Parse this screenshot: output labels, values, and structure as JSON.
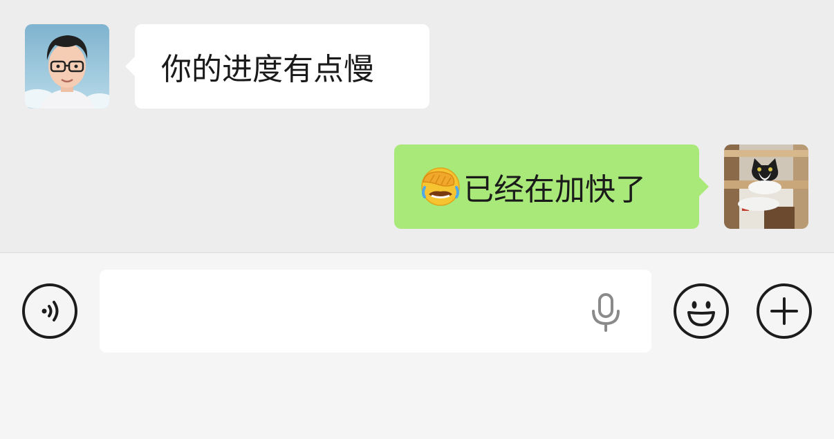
{
  "messages": [
    {
      "side": "left",
      "text": "你的进度有点慢",
      "avatar": "man-with-glasses-avatar"
    },
    {
      "side": "right",
      "emoji": "face-with-hand-over-eyes-laughing-emoji",
      "text": "已经在加快了",
      "avatar": "black-white-cat-avatar"
    }
  ],
  "input_bar": {
    "input_value": "",
    "placeholder": "",
    "icons": [
      "voice-icon",
      "microphone-icon",
      "emoji-icon",
      "plus-icon"
    ]
  },
  "colors": {
    "chat_background": "#ededed",
    "incoming_bubble": "#ffffff",
    "outgoing_bubble": "#a9e97a",
    "input_bar_background": "#f5f5f5"
  }
}
